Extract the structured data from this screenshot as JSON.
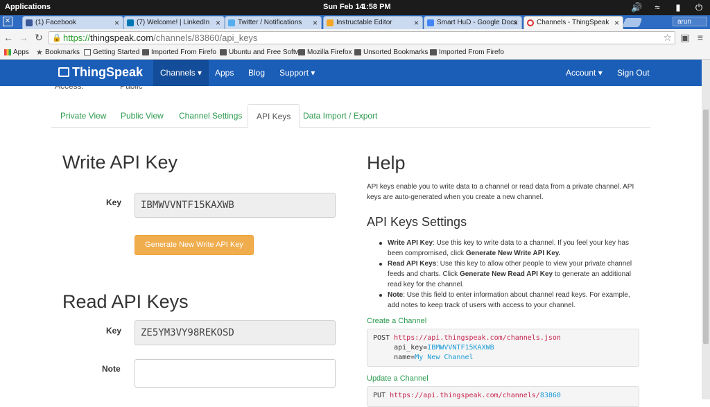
{
  "os": {
    "apps_label": "Applications",
    "date": "Sun Feb 14",
    "time": "1:58 PM"
  },
  "browser": {
    "tabs": [
      {
        "title": "(1) Facebook",
        "favicon_color": "#3b5998"
      },
      {
        "title": "(7) Welcome! | LinkedIn",
        "favicon_color": "#0077b5"
      },
      {
        "title": "Twitter / Notifications",
        "favicon_color": "#55acee"
      },
      {
        "title": "Instructable Editor",
        "favicon_color": "#f5a623"
      },
      {
        "title": "Smart HuD - Google Docs",
        "favicon_color": "#4285f4"
      },
      {
        "title": "Channels - ThingSpeak",
        "favicon_color": "#d9302f"
      }
    ],
    "user": "arun",
    "url_scheme": "https://",
    "url_host": "thingspeak.com",
    "url_path": "/channels/83860/api_keys",
    "bookmarks": [
      {
        "label": "Apps"
      },
      {
        "label": "Bookmarks"
      },
      {
        "label": "Getting Started"
      },
      {
        "label": "Imported From Firefo"
      },
      {
        "label": "Ubuntu and Free Softw"
      },
      {
        "label": "Mozilla Firefox"
      },
      {
        "label": "Unsorted Bookmarks"
      },
      {
        "label": "Imported From Firefo"
      }
    ]
  },
  "header": {
    "brand": "ThingSpeak",
    "nav": [
      "Channels ▾",
      "Apps",
      "Blog",
      "Support ▾"
    ],
    "account": "Account ▾",
    "signout": "Sign Out",
    "brand_color": "#1b5eb7"
  },
  "cut_text": {
    "label": "Access:",
    "value": "Public"
  },
  "page_tabs": [
    "Private View",
    "Public View",
    "Channel Settings",
    "API Keys",
    "Data Import / Export"
  ],
  "write": {
    "title": "Write API Key",
    "key_label": "Key",
    "key_value": "IBMWVVNTF15KAXWB",
    "button": "Generate New Write API Key"
  },
  "read": {
    "title": "Read API Keys",
    "key_label": "Key",
    "key_value": "ZE5YM3VY98REKOSD",
    "note_label": "Note"
  },
  "help": {
    "title": "Help",
    "intro_1": "API keys enable you to write data to a channel or read data from a private channel. API",
    "intro_2": "keys are auto-generated when you create a new channel.",
    "settings_title": "API Keys Settings",
    "bullets": [
      {
        "lines": [
          "<b>Write API Key</b>: Use this key to write data to a channel. If you feel your key has",
          "been compromised, click <b>Generate New Write API Key.</b>"
        ]
      },
      {
        "lines": [
          "<b>Read API Keys</b>: Use this key to allow other people to view your private channel",
          "feeds and charts. Click <b>Generate New Read API Key</b> to generate an additional",
          "read key for the channel."
        ]
      },
      {
        "lines": [
          "<b>Note</b>: Use this field to enter information about channel read keys. For example,",
          "add notes to keep track of users with access to your channel."
        ]
      }
    ],
    "create_title": "Create a Channel",
    "create_code": {
      "method": "POST",
      "url": "https://api.thingspeak.com/channels.json",
      "p1_key": "api_key=",
      "p1_val": "IBMWVVNTF15KAXWB",
      "p2_key": "name=",
      "p2_val": "My New Channel"
    },
    "update_title": "Update a Channel",
    "update_code": {
      "method": "PUT",
      "url": "https://api.thingspeak.com/channels/",
      "id": "83860"
    }
  }
}
